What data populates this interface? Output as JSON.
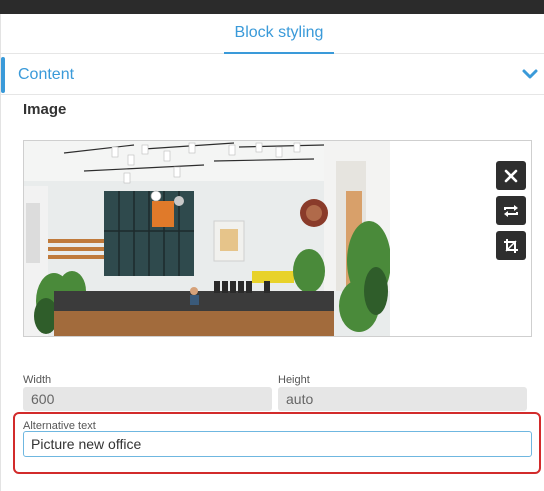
{
  "tabs": {
    "active_label": "Block styling"
  },
  "section": {
    "title": "Content"
  },
  "image_block": {
    "label": "Image"
  },
  "dimensions": {
    "width_label": "Width",
    "width_value": "600",
    "height_label": "Height",
    "height_value": "auto"
  },
  "alt_text": {
    "label": "Alternative text",
    "value": "Picture new office"
  },
  "icons": {
    "section_toggle": "chevron-down-icon",
    "remove": "close-icon",
    "replace": "swap-icon",
    "crop": "crop-icon"
  },
  "colors": {
    "accent": "#3a9ad9",
    "highlight": "#d22b2b",
    "dark_button": "#2e2e2e"
  }
}
